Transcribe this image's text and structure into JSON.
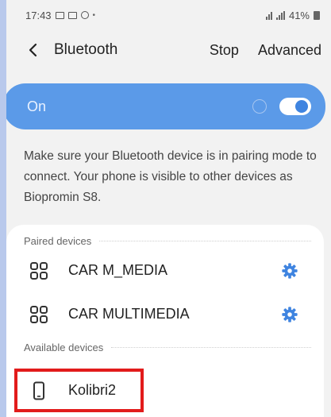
{
  "status_bar": {
    "time": "17:43",
    "battery": "41%"
  },
  "header": {
    "title": "Bluetooth",
    "stop_label": "Stop",
    "advanced_label": "Advanced"
  },
  "toggle": {
    "label": "On",
    "state": "on"
  },
  "info_text": "Make sure your Bluetooth device is in pairing mode to connect. Your phone is visible to other devices as Biopromin S8.",
  "paired": {
    "header": "Paired devices",
    "devices": [
      {
        "name": "CAR M_MEDIA",
        "icon": "car-multimedia-icon"
      },
      {
        "name": "CAR MULTIMEDIA",
        "icon": "car-multimedia-icon"
      }
    ]
  },
  "available": {
    "header": "Available devices",
    "devices": [
      {
        "name": "Kolibri2",
        "icon": "phone-icon"
      }
    ]
  },
  "colors": {
    "accent": "#5b9ae8",
    "highlight": "#e21b1b",
    "gear": "#3f84e0"
  }
}
